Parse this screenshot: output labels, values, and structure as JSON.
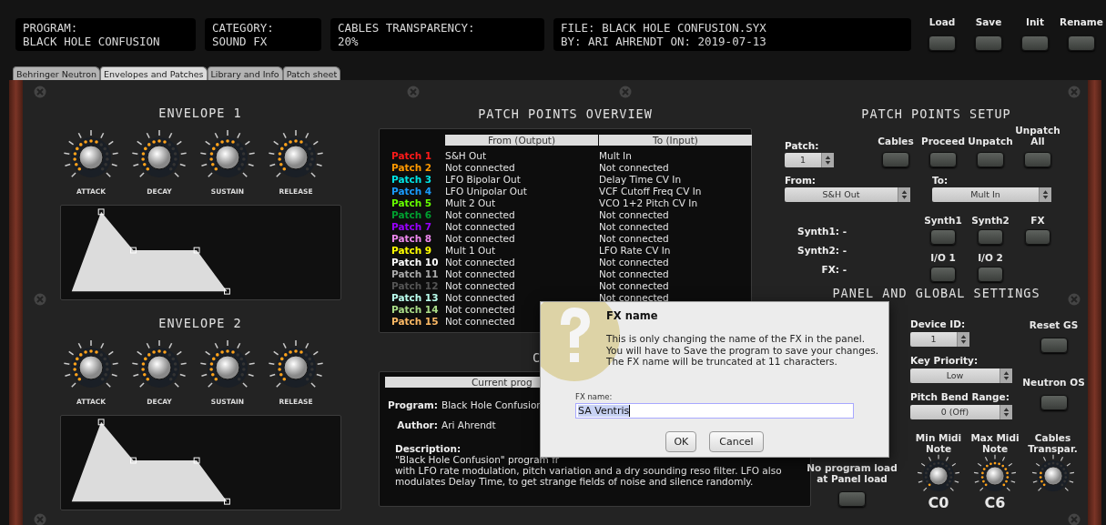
{
  "header": {
    "displays": [
      {
        "lines": [
          "PROGRAM:",
          "BLACK HOLE CONFUSION"
        ]
      },
      {
        "lines": [
          "CATEGORY:",
          "SOUND FX"
        ]
      },
      {
        "lines": [
          "CABLES TRANSPARENCY:",
          "20%"
        ]
      },
      {
        "lines": [
          "FILE: BLACK HOLE CONFUSION.SYX",
          "BY: ARI AHRENDT ON: 2019-07-13"
        ]
      }
    ],
    "buttons": [
      "Load",
      "Save",
      "Init",
      "Rename"
    ]
  },
  "tabs": [
    {
      "label": "Behringer Neutron",
      "selected": false
    },
    {
      "label": "Envelopes and Patches",
      "selected": true
    },
    {
      "label": "Library and Info",
      "selected": false
    },
    {
      "label": "Patch sheet",
      "selected": false
    }
  ],
  "envelopes": [
    {
      "title": "ENVELOPE 1",
      "knobs": [
        "ATTACK",
        "DECAY",
        "SUSTAIN",
        "RELEASE"
      ]
    },
    {
      "title": "ENVELOPE 2",
      "knobs": [
        "ATTACK",
        "DECAY",
        "SUSTAIN",
        "RELEASE"
      ]
    }
  ],
  "patch_overview": {
    "title": "PATCH POINTS OVERVIEW",
    "columns": [
      "From (Output)",
      "To (Input)"
    ],
    "rows": [
      {
        "label": "Patch 1",
        "color": "#ff1a1a",
        "from": "S&H Out",
        "to": "Mult In"
      },
      {
        "label": "Patch 2",
        "color": "#ff9900",
        "from": "Not connected",
        "to": "Not connected"
      },
      {
        "label": "Patch 3",
        "color": "#00e5e5",
        "from": "LFO Bipolar Out",
        "to": "Delay Time CV In"
      },
      {
        "label": "Patch 4",
        "color": "#1a9cff",
        "from": "LFO Unipolar Out",
        "to": "VCF Cutoff Freq CV In"
      },
      {
        "label": "Patch 5",
        "color": "#66ff00",
        "from": "Mult 2 Out",
        "to": "VCO 1+2 Pitch CV In"
      },
      {
        "label": "Patch 6",
        "color": "#00a030",
        "from": "Not connected",
        "to": "Not connected"
      },
      {
        "label": "Patch 7",
        "color": "#9900ff",
        "from": "Not connected",
        "to": "Not connected"
      },
      {
        "label": "Patch 8",
        "color": "#ee88ee",
        "from": "Not connected",
        "to": "Not connected"
      },
      {
        "label": "Patch 9",
        "color": "#ffff00",
        "from": "Mult 1 Out",
        "to": "LFO Rate CV In"
      },
      {
        "label": "Patch 10",
        "color": "#ffffff",
        "from": "Not connected",
        "to": "Not connected"
      },
      {
        "label": "Patch 11",
        "color": "#aaaaaa",
        "from": "Not connected",
        "to": "Not connected"
      },
      {
        "label": "Patch 12",
        "color": "#555555",
        "from": "Not connected",
        "to": "Not connected"
      },
      {
        "label": "Patch 13",
        "color": "#bbffee",
        "from": "Not connected",
        "to": "Not connected"
      },
      {
        "label": "Patch 14",
        "color": "#aadd88",
        "from": "Not connected"
      },
      {
        "label": "Patch 15",
        "color": "#ffbb66",
        "from": "Not connected"
      }
    ]
  },
  "program_info": {
    "title": "C",
    "header": "Current prog",
    "fields": [
      {
        "label": "Program:",
        "value": "Black Hole Confusion"
      },
      {
        "label": "Author:",
        "value": "Ari Ahrendt"
      }
    ],
    "description_label": "Description:",
    "description_lines": [
      "\"Black Hole Confusion\" program fr",
      "with LFO rate modulation, pitch variation and a dry sounding reso filter. LFO also",
      "modulates Delay Time, to get strange fields of noise and silence randomly."
    ]
  },
  "patch_setup": {
    "title": "PATCH POINTS SETUP",
    "patch_label": "Patch:",
    "patch_value": "1",
    "buttons": [
      "Cables",
      "Proceed",
      "Unpatch",
      "Unpatch All"
    ],
    "from_label": "From:",
    "from_value": "S&H Out",
    "to_label": "To:",
    "to_value": "Mult In",
    "status": [
      "Synth1: -",
      "Synth2: -",
      "FX: -"
    ],
    "target_buttons": [
      "Synth1",
      "Synth2",
      "FX",
      "I/O 1",
      "I/O 2"
    ]
  },
  "global_settings": {
    "title": "PANEL AND GLOBAL SETTINGS",
    "device_id_label": "Device ID:",
    "device_id": "1",
    "key_priority_label": "Key Priority:",
    "key_priority": "Low",
    "pitch_bend_label": "Pitch Bend Range:",
    "pitch_bend": "0 (Off)",
    "reset_button": "Reset GS",
    "os_button": "Neutron OS",
    "no_load_label": "No program load at Panel load",
    "knobs": [
      {
        "label": "Min Midi Note",
        "value": "C0"
      },
      {
        "label": "Max Midi Note",
        "value": "C6"
      },
      {
        "label": "Cables Transpar."
      }
    ]
  },
  "dialog": {
    "title": "FX name",
    "message_lines": [
      "This is only changing the name of the FX in the panel.",
      "You will have to Save the program to save your changes.",
      "The FX name will be truncated at 11 characters."
    ],
    "field_label": "FX name:",
    "field_value": "SA Ventris",
    "buttons": [
      "OK",
      "Cancel"
    ]
  }
}
